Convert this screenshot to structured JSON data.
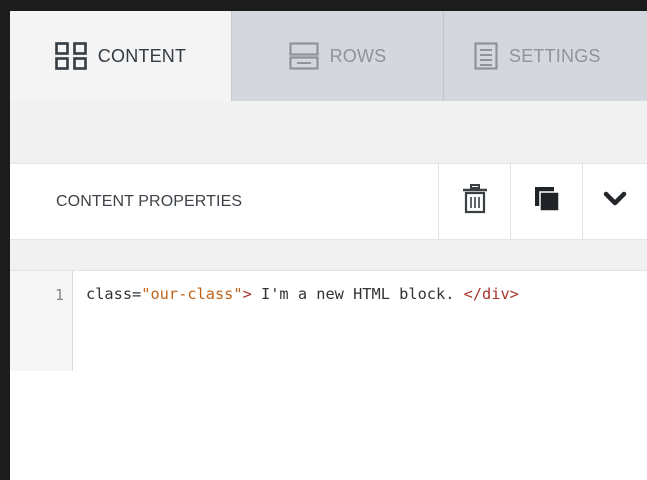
{
  "tabs": [
    {
      "label": "CONTENT",
      "icon": "grid-icon",
      "active": true
    },
    {
      "label": "ROWS",
      "icon": "rows-icon",
      "active": false
    },
    {
      "label": "SETTINGS",
      "icon": "settings-doc-icon",
      "active": false
    }
  ],
  "properties": {
    "title": "CONTENT PROPERTIES",
    "actions": [
      {
        "icon": "trash-icon"
      },
      {
        "icon": "duplicate-icon"
      },
      {
        "icon": "chevron-down-icon"
      }
    ]
  },
  "editor": {
    "line_number": "1",
    "tokens": {
      "attr": "class=",
      "value": "\"our-class\"",
      "close": ">",
      "text": " I'm a new HTML block. ",
      "end_tag": "</div>"
    }
  },
  "colors": {
    "tab_bar": "#d4d7db",
    "tab_active": "#f4f4f4",
    "string": "#c0641a",
    "tag": "#a6332c"
  }
}
